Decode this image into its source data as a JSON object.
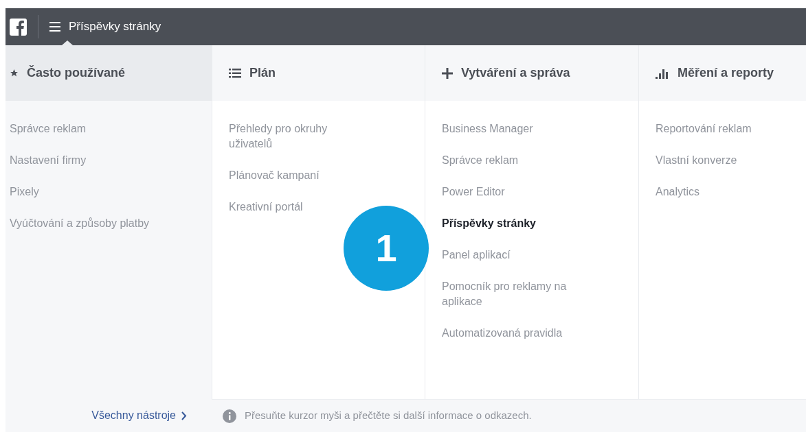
{
  "top_bar": {
    "title": "Příspěvky stránky"
  },
  "columns": [
    {
      "kind": "star",
      "title": "Často používané",
      "selected": true,
      "items": [
        {
          "label": "Správce reklam",
          "selected": false
        },
        {
          "label": "Nastavení firmy",
          "selected": false
        },
        {
          "label": "Pixely",
          "selected": false
        },
        {
          "label": "Vyúčtování a způsoby platby",
          "selected": false
        }
      ]
    },
    {
      "kind": "list",
      "title": "Plán",
      "selected": false,
      "items": [
        {
          "label": "Přehledy pro okruhy uživatelů",
          "selected": false
        },
        {
          "label": "Plánovač kampaní",
          "selected": false
        },
        {
          "label": "Kreativní portál",
          "selected": false
        }
      ]
    },
    {
      "kind": "plus",
      "title": "Vytváření a správa",
      "selected": false,
      "items": [
        {
          "label": "Business Manager",
          "selected": false
        },
        {
          "label": "Správce reklam",
          "selected": false
        },
        {
          "label": "Power Editor",
          "selected": false
        },
        {
          "label": "Příspěvky stránky",
          "selected": true
        },
        {
          "label": "Panel aplikací",
          "selected": false
        },
        {
          "label": "Pomocník pro reklamy na aplikace",
          "selected": false
        },
        {
          "label": "Automatizovaná pravidla",
          "selected": false
        }
      ]
    },
    {
      "kind": "bars",
      "title": "Měření a reporty",
      "selected": false,
      "items": [
        {
          "label": "Reportování reklam",
          "selected": false
        },
        {
          "label": "Vlastní konverze",
          "selected": false
        },
        {
          "label": "Analytics",
          "selected": false
        }
      ]
    }
  ],
  "footer": {
    "all_tools": "Všechny nástroje",
    "hint": "Přesuňte kurzor myši a přečtěte si další informace o odkazech."
  },
  "badge": "1"
}
